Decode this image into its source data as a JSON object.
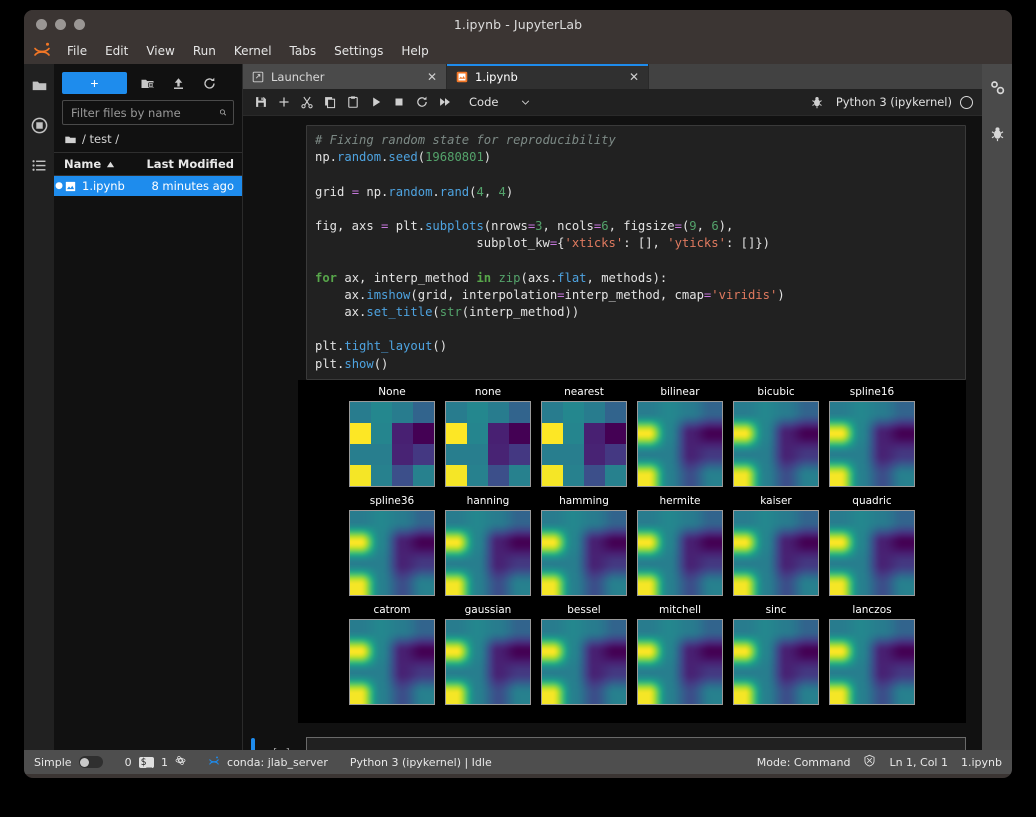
{
  "window": {
    "title": "1.ipynb - JupyterLab"
  },
  "menu": {
    "items": [
      "File",
      "Edit",
      "View",
      "Run",
      "Kernel",
      "Tabs",
      "Settings",
      "Help"
    ]
  },
  "activitybar": {
    "items": [
      {
        "name": "folder-icon",
        "label": "File Browser"
      },
      {
        "name": "running-icon",
        "label": "Running Terminals and Kernels"
      },
      {
        "name": "list-icon",
        "label": "Table of Contents"
      }
    ]
  },
  "filebrowser": {
    "new_button_label": "+",
    "toolbar_icons": [
      "new-folder-icon",
      "upload-icon",
      "refresh-icon"
    ],
    "filter_placeholder": "Filter files by name",
    "filter_value": "",
    "breadcrumb": "/ test /",
    "columns": [
      "Name",
      "Last Modified"
    ],
    "rows": [
      {
        "name": "1.ipynb",
        "modified": "8 minutes ago",
        "icon": "notebook-icon",
        "selected": true,
        "dirty": true
      }
    ]
  },
  "tabs": [
    {
      "label": "Launcher",
      "icon": "launcher-icon",
      "active": false
    },
    {
      "label": "1.ipynb",
      "icon": "notebook-icon",
      "active": true
    }
  ],
  "notebook_toolbar": {
    "icons": [
      "save-icon",
      "add-cell-icon",
      "cut-icon",
      "copy-icon",
      "paste-icon",
      "run-icon",
      "stop-icon",
      "restart-icon",
      "restart-run-all-icon"
    ],
    "cell_type": "Code",
    "debugger_icon": "bug-icon",
    "kernel_name": "Python 3 (ipykernel)",
    "kernel_status": "idle"
  },
  "cells": [
    {
      "prompt": "",
      "type": "code",
      "lines": [
        [
          {
            "t": "# Fixing random state for reproducibility",
            "c": "c-com"
          }
        ],
        [
          {
            "t": "np.",
            "c": ""
          },
          {
            "t": "random",
            "c": "c-fn"
          },
          {
            "t": ".",
            "c": ""
          },
          {
            "t": "seed",
            "c": "c-fn"
          },
          {
            "t": "(",
            "c": ""
          },
          {
            "t": "19680801",
            "c": "c-num"
          },
          {
            "t": ")",
            "c": ""
          }
        ],
        [],
        [
          {
            "t": "grid ",
            "c": ""
          },
          {
            "t": "=",
            "c": "c-mag"
          },
          {
            "t": " np.",
            "c": ""
          },
          {
            "t": "random",
            "c": "c-fn"
          },
          {
            "t": ".",
            "c": ""
          },
          {
            "t": "rand",
            "c": "c-fn"
          },
          {
            "t": "(",
            "c": ""
          },
          {
            "t": "4",
            "c": "c-num"
          },
          {
            "t": ", ",
            "c": ""
          },
          {
            "t": "4",
            "c": "c-num"
          },
          {
            "t": ")",
            "c": ""
          }
        ],
        [],
        [
          {
            "t": "fig, axs ",
            "c": ""
          },
          {
            "t": "=",
            "c": "c-mag"
          },
          {
            "t": " plt.",
            "c": ""
          },
          {
            "t": "subplots",
            "c": "c-fn"
          },
          {
            "t": "(nrows",
            "c": ""
          },
          {
            "t": "=",
            "c": "c-mag"
          },
          {
            "t": "3",
            "c": "c-num"
          },
          {
            "t": ", ncols",
            "c": ""
          },
          {
            "t": "=",
            "c": "c-mag"
          },
          {
            "t": "6",
            "c": "c-num"
          },
          {
            "t": ", figsize",
            "c": ""
          },
          {
            "t": "=",
            "c": "c-mag"
          },
          {
            "t": "(",
            "c": ""
          },
          {
            "t": "9",
            "c": "c-num"
          },
          {
            "t": ", ",
            "c": ""
          },
          {
            "t": "6",
            "c": "c-num"
          },
          {
            "t": "),",
            "c": ""
          }
        ],
        [
          {
            "t": "                      subplot_kw",
            "c": ""
          },
          {
            "t": "=",
            "c": "c-mag"
          },
          {
            "t": "{",
            "c": ""
          },
          {
            "t": "'xticks'",
            "c": "c-str"
          },
          {
            "t": ": [], ",
            "c": ""
          },
          {
            "t": "'yticks'",
            "c": "c-str"
          },
          {
            "t": ": []})",
            "c": ""
          }
        ],
        [],
        [
          {
            "t": "for",
            "c": "c-kw"
          },
          {
            "t": " ax, interp_method ",
            "c": ""
          },
          {
            "t": "in",
            "c": "c-kw"
          },
          {
            "t": " ",
            "c": ""
          },
          {
            "t": "zip",
            "c": "c-num"
          },
          {
            "t": "(axs.",
            "c": ""
          },
          {
            "t": "flat",
            "c": "c-fn"
          },
          {
            "t": ", methods):",
            "c": ""
          }
        ],
        [
          {
            "t": "    ax.",
            "c": ""
          },
          {
            "t": "imshow",
            "c": "c-fn"
          },
          {
            "t": "(grid, interpolation",
            "c": ""
          },
          {
            "t": "=",
            "c": "c-mag"
          },
          {
            "t": "interp_method, cmap",
            "c": ""
          },
          {
            "t": "=",
            "c": "c-mag"
          },
          {
            "t": "'viridis'",
            "c": "c-str"
          },
          {
            "t": ")",
            "c": ""
          }
        ],
        [
          {
            "t": "    ax.",
            "c": ""
          },
          {
            "t": "set_title",
            "c": "c-fn"
          },
          {
            "t": "(",
            "c": ""
          },
          {
            "t": "str",
            "c": "c-num"
          },
          {
            "t": "(interp_method))",
            "c": ""
          }
        ],
        [],
        [
          {
            "t": "plt.",
            "c": ""
          },
          {
            "t": "tight_layout",
            "c": "c-fn"
          },
          {
            "t": "()",
            "c": ""
          }
        ],
        [
          {
            "t": "plt.",
            "c": ""
          },
          {
            "t": "show",
            "c": "c-fn"
          },
          {
            "t": "()",
            "c": ""
          }
        ]
      ]
    }
  ],
  "empty_cell": {
    "prompt": "[ ]:",
    "value": "",
    "active": true
  },
  "chart_data": {
    "type": "heatmap",
    "title": "",
    "colormap": "viridis",
    "grid_shape": [
      4,
      4
    ],
    "grid_values": [
      [
        0.46,
        0.51,
        0.46,
        0.36
      ],
      [
        0.97,
        0.5,
        0.12,
        0.03
      ],
      [
        0.47,
        0.47,
        0.13,
        0.2
      ],
      [
        0.96,
        0.48,
        0.28,
        0.48
      ]
    ],
    "grid_colors": [
      [
        "#5ab471",
        "#67bd6d",
        "#5db46f",
        "#469b8c"
      ],
      [
        "#f6e martial",
        "#5fb970",
        "#413d7b",
        "#3a0f52"
      ],
      [
        "#5cb46f",
        "#5fb56f",
        "#3e3d79",
        "#404a8c"
      ],
      [
        "#f7e44e",
        "#5eb76f",
        "#3d7694",
        "#5eb96f"
      ]
    ],
    "subplot_rows": 3,
    "subplot_cols": 6,
    "figsize": [
      9,
      6
    ],
    "panels": [
      {
        "title": "None",
        "interpolation": "none",
        "smooth": false
      },
      {
        "title": "none",
        "interpolation": "none",
        "smooth": false
      },
      {
        "title": "nearest",
        "interpolation": "nearest",
        "smooth": false
      },
      {
        "title": "bilinear",
        "interpolation": "bilinear",
        "smooth": true
      },
      {
        "title": "bicubic",
        "interpolation": "bicubic",
        "smooth": true
      },
      {
        "title": "spline16",
        "interpolation": "spline16",
        "smooth": true
      },
      {
        "title": "spline36",
        "interpolation": "spline36",
        "smooth": true
      },
      {
        "title": "hanning",
        "interpolation": "hanning",
        "smooth": true
      },
      {
        "title": "hamming",
        "interpolation": "hamming",
        "smooth": true
      },
      {
        "title": "hermite",
        "interpolation": "hermite",
        "smooth": true
      },
      {
        "title": "kaiser",
        "interpolation": "kaiser",
        "smooth": true
      },
      {
        "title": "quadric",
        "interpolation": "quadric",
        "smooth": true
      },
      {
        "title": "catrom",
        "interpolation": "catrom",
        "smooth": true
      },
      {
        "title": "gaussian",
        "interpolation": "gaussian",
        "smooth": true
      },
      {
        "title": "bessel",
        "interpolation": "bessel",
        "smooth": true
      },
      {
        "title": "mitchell",
        "interpolation": "mitchell",
        "smooth": true
      },
      {
        "title": "sinc",
        "interpolation": "sinc",
        "smooth": true
      },
      {
        "title": "lanczos",
        "interpolation": "lanczos",
        "smooth": true
      }
    ],
    "background": "#000000"
  },
  "statusbar": {
    "simple_label": "Simple",
    "simple_on": false,
    "terminal_count": "0",
    "kernel_count": "1",
    "conda_env": "conda: jlab_server",
    "kernel_status": "Python 3 (ipykernel) | Idle",
    "mode": "Mode: Command",
    "position": "Ln 1, Col 1",
    "filename": "1.ipynb"
  },
  "rightbar": {
    "items": [
      {
        "name": "property-inspector-icon"
      },
      {
        "name": "debugger-icon"
      }
    ]
  },
  "colors": {
    "accent": "#1e8ced",
    "titlebar": "#3b3533",
    "panel": "#111111",
    "toolbar": "#212121",
    "statusbar": "#4e4e4e"
  }
}
